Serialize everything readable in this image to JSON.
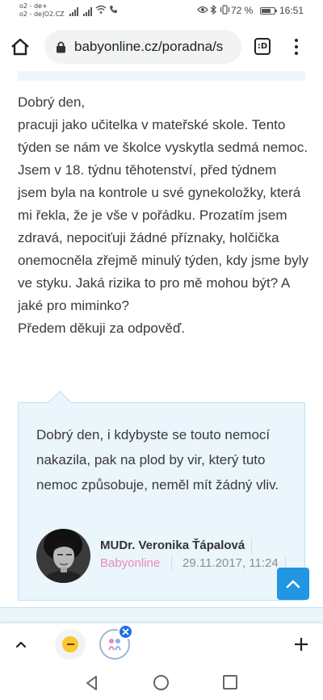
{
  "status_bar": {
    "carrier_line1": "o2 - de+",
    "carrier_line2": "o2 - de|O2.CZ",
    "battery_percent": "72 %",
    "battery_level": 0.72,
    "time": "16:51"
  },
  "browser": {
    "url": "babyonline.cz/poradna/s",
    "tabs_label": ":D"
  },
  "question": {
    "paragraphs": [
      "Dobrý den,",
      "pracuji jako učitelka v mateřské skole. Tento týden se nám ve školce vyskytla sedmá nemoc. Jsem v 18. týdnu těhotenství, před týdnem jsem byla na kontrole u své gynekoložky, která mi řekla, že je vše v pořádku. Prozatím jsem zdravá, nepociťuji žádné příznaky, holčička onemocněla zřejmě minulý týden, kdy jsme byly ve styku. Jaká rizika to pro mě mohou být? A jaké pro miminko?",
      "Předem děkuji za odpověď."
    ]
  },
  "answer": {
    "text": "Dobrý den, i kdybyste se touto nemocí nakazila, pak na plod by vir, který tuto nemoc způsobuje, neměl mít žádný vliv.",
    "author": "MUDr. Veronika Ťápalová",
    "source": "Babyonline",
    "date": "29.11.2017, 11:24"
  },
  "colors": {
    "accent": "#2196e3",
    "answer_bg": "#eaf5fc",
    "answer_border": "#bfe3f5",
    "source_pink": "#e58bb8"
  },
  "icons": {
    "home": "home-icon",
    "lock": "lock-icon",
    "menu": "more-vert-icon",
    "scroll_top": "chevron-up-icon",
    "up": "chevron-up-icon",
    "emoji": "emoji-icon",
    "favicon": "babyonline-favicon-icon",
    "close": "close-icon",
    "plus": "plus-icon",
    "nav_back": "triangle-back-icon",
    "nav_home": "circle-home-icon",
    "nav_recent": "square-recent-icon"
  }
}
